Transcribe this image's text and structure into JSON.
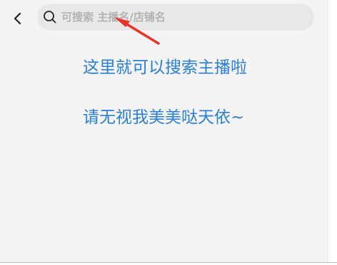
{
  "header": {
    "back_icon": "chevron-left-icon",
    "search": {
      "icon": "search-icon",
      "placeholder": "可搜索 主播名/店铺名",
      "value": ""
    }
  },
  "annotations": {
    "color": "#2b7fd4",
    "arrow_color": "#e8332a",
    "lines": [
      "这里就可以搜索主播啦",
      "请无视我美美哒天依~"
    ]
  }
}
